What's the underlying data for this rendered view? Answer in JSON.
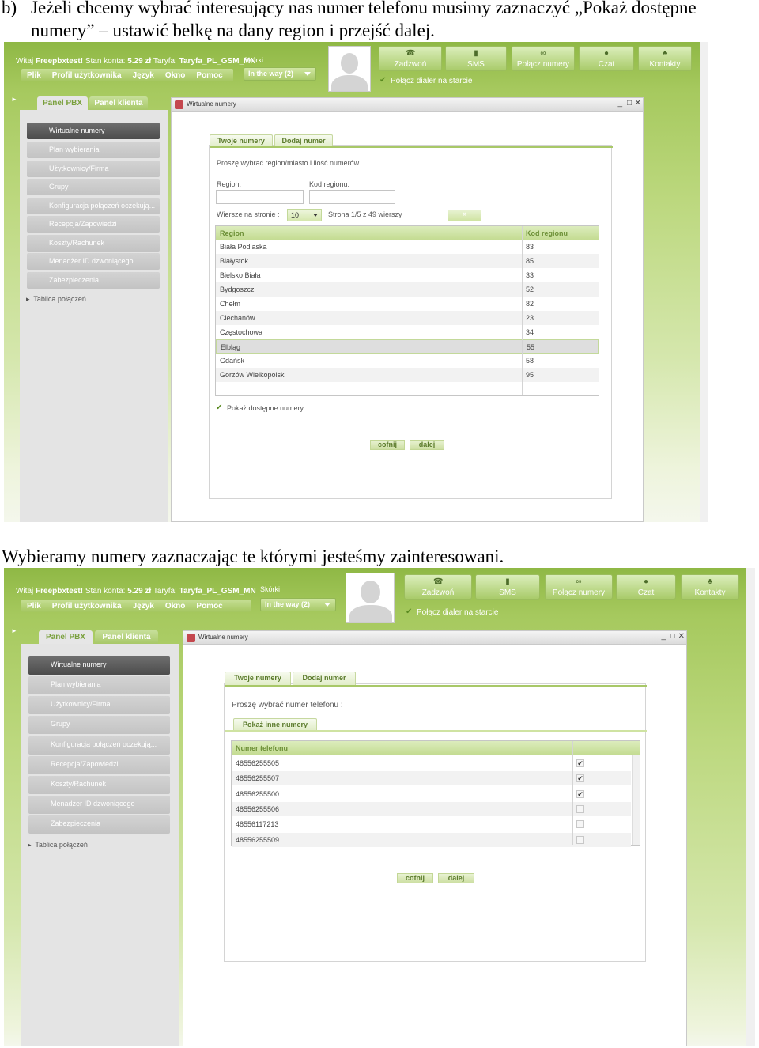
{
  "caption_b": {
    "prefix": "b)",
    "line1": "Jeżeli chcemy wybrać interesujący nas numer telefonu musimy zaznaczyć „Pokaż dostępne",
    "line2": "numery” – ustawić belkę na dany region i przejść dalej."
  },
  "caption_2": "Wybieramy numery zaznaczając te którymi jesteśmy zainteresowani.",
  "app": {
    "greeting": "Witaj",
    "user": "Freepbxtest!",
    "balance_label": "Stan konta:",
    "balance": "5.29 zł",
    "tariff_label": "Taryfa:",
    "tariff": "Taryfa_PL_GSM_MN",
    "menu": [
      "Plik",
      "Profil użytkownika",
      "Język",
      "Okno",
      "Pomoc"
    ],
    "skins_label": "Skórki",
    "skin_value": "In the way (2)",
    "toolbar": [
      {
        "label": "Zadzwoń",
        "icon": "phone-icon"
      },
      {
        "label": "SMS",
        "icon": "mobile-icon"
      },
      {
        "label": "Połącz numery",
        "icon": "link-icon"
      },
      {
        "label": "Czat",
        "icon": "chat-icon"
      },
      {
        "label": "Kontakty",
        "icon": "contacts-icon"
      }
    ],
    "dialer_label": "Połącz dialer na starcie",
    "panel_tabs": [
      "Panel PBX",
      "Panel klienta"
    ],
    "sidebar": [
      "Wirtualne numery",
      "Plan wybierania",
      "Użytkownicy/Firma",
      "Grupy",
      "Konfiguracja połączeń oczekują...",
      "Recepcja/Zapowiedzi",
      "Koszty/Rachunek",
      "Menadżer ID dzwoniącego",
      "Zabezpieczenia"
    ],
    "tree_item": "Tablica połączeń",
    "window_title": "Wirtualne numery",
    "tabs": [
      "Twoje numery",
      "Dodaj numer"
    ]
  },
  "screen1": {
    "instruction": "Proszę wybrać region/miasto i ilość numerów",
    "region_label": "Region:",
    "code_label": "Kod regionu:",
    "rows_label": "Wiersze na stronie :",
    "rows_value": "10",
    "page_info": "Strona 1/5 z 49 wierszy",
    "next_label": "»",
    "columns": [
      "Region",
      "Kod regionu"
    ],
    "rows": [
      [
        "Biała Podlaska",
        "83"
      ],
      [
        "Białystok",
        "85"
      ],
      [
        "Bielsko Biała",
        "33"
      ],
      [
        "Bydgoszcz",
        "52"
      ],
      [
        "Chełm",
        "82"
      ],
      [
        "Ciechanów",
        "23"
      ],
      [
        "Częstochowa",
        "34"
      ],
      [
        "Elbląg",
        "55"
      ],
      [
        "Gdańsk",
        "58"
      ],
      [
        "Gorzów Wielkopolski",
        "95"
      ]
    ],
    "selected_row": 7,
    "show_available": "Pokaż dostępne numery",
    "back": "cofnij",
    "next": "dalej"
  },
  "screen2": {
    "instruction": "Proszę wybrać numer telefonu :",
    "show_other": "Pokaż inne numery",
    "column": "Numer telefonu",
    "numbers": [
      {
        "n": "48556255505",
        "checked": true
      },
      {
        "n": "48556255507",
        "checked": true
      },
      {
        "n": "48556255500",
        "checked": true
      },
      {
        "n": "48556255506",
        "checked": false
      },
      {
        "n": "48556117213",
        "checked": false
      },
      {
        "n": "48556255509",
        "checked": false
      }
    ],
    "back": "cofnij",
    "next": "dalej"
  }
}
